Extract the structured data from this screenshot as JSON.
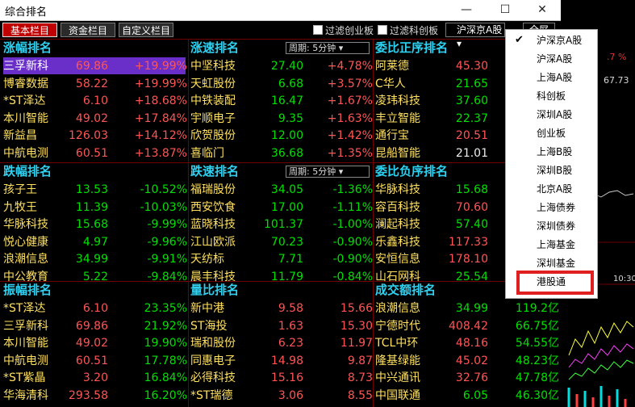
{
  "window": {
    "title": "综合排名",
    "minimize": "—",
    "maximize": "☐",
    "close": "✕"
  },
  "toolbar": {
    "tabs": [
      "基本栏目",
      "资金栏目",
      "自定义栏目"
    ],
    "filter1": "过滤创业板",
    "filter2": "过滤科创板",
    "market": "沪深京A股",
    "full": "全屏"
  },
  "period_label": "周期: 5分钟",
  "panels": {
    "gainers": {
      "title": "涨幅排名",
      "rows": [
        [
          "三孚新科",
          "69.86",
          "+19.99%"
        ],
        [
          "博睿数据",
          "58.22",
          "+19.99%"
        ],
        [
          "*ST泽达",
          "6.10",
          "+18.68%"
        ],
        [
          "本川智能",
          "49.02",
          "+17.84%"
        ],
        [
          "新益昌",
          "126.03",
          "+14.12%"
        ],
        [
          "中航电测",
          "60.51",
          "+13.87%"
        ]
      ]
    },
    "speed_up": {
      "title": "涨速排名",
      "rows": [
        [
          "中坚科技",
          "27.40",
          "+4.78%"
        ],
        [
          "天虹股份",
          "6.68",
          "+3.57%"
        ],
        [
          "中铁装配",
          "16.47",
          "+1.67%"
        ],
        [
          "宇顺电子",
          "9.35",
          "+1.63%"
        ],
        [
          "欣贺股份",
          "12.00",
          "+1.42%"
        ],
        [
          "喜临门",
          "36.68",
          "+1.35%"
        ]
      ]
    },
    "bid_pos": {
      "title": "委比正序排名",
      "rows": [
        [
          "阿莱德",
          "45.30"
        ],
        [
          "C华人",
          "21.65"
        ],
        [
          "凌玮科技",
          "37.60"
        ],
        [
          "丰立智能",
          "22.37"
        ],
        [
          "通行宝",
          "20.51"
        ],
        [
          "昆船智能",
          "21.01"
        ]
      ]
    },
    "losers": {
      "title": "跌幅排名",
      "rows": [
        [
          "孩子王",
          "13.53",
          "-10.52%"
        ],
        [
          "九牧王",
          "11.39",
          "-10.03%"
        ],
        [
          "华脉科技",
          "15.68",
          "-9.99%"
        ],
        [
          "悦心健康",
          "4.97",
          "-9.96%"
        ],
        [
          "浪潮信息",
          "34.99",
          "-9.91%"
        ],
        [
          "中公教育",
          "5.22",
          "-9.84%"
        ]
      ]
    },
    "speed_down": {
      "title": "跌速排名",
      "rows": [
        [
          "福瑞股份",
          "34.05",
          "-1.36%"
        ],
        [
          "西安饮食",
          "17.00",
          "-1.11%"
        ],
        [
          "蓝晓科技",
          "101.37",
          "-1.00%"
        ],
        [
          "江山欧派",
          "70.23",
          "-0.90%"
        ],
        [
          "天纺标",
          "7.71",
          "-0.90%"
        ],
        [
          "晨丰科技",
          "11.79",
          "-0.84%"
        ]
      ]
    },
    "bid_neg": {
      "title": "委比负序排名",
      "rows": [
        [
          "华脉科技",
          "15.68"
        ],
        [
          "容百科技",
          "70.60"
        ],
        [
          "澜起科技",
          "57.40"
        ],
        [
          "乐鑫科技",
          "117.33"
        ],
        [
          "安恒信息",
          "178.10"
        ],
        [
          "山石网科",
          "25.54"
        ]
      ]
    },
    "amplitude": {
      "title": "振幅排名",
      "rows": [
        [
          "*ST泽达",
          "6.10",
          "23.35%"
        ],
        [
          "三孚新科",
          "69.86",
          "21.92%"
        ],
        [
          "本川智能",
          "49.02",
          "19.90%"
        ],
        [
          "中航电测",
          "60.51",
          "17.78%"
        ],
        [
          "*ST紫晶",
          "3.20",
          "16.84%"
        ],
        [
          "华海清科",
          "293.58",
          "16.20%"
        ]
      ]
    },
    "volume_ratio": {
      "title": "量比排名",
      "rows": [
        [
          "新中港",
          "9.58",
          "15.66"
        ],
        [
          "ST海投",
          "1.63",
          "15.30"
        ],
        [
          "瑞和股份",
          "6.23",
          "11.97"
        ],
        [
          "同惠电子",
          "14.98",
          "9.87"
        ],
        [
          "必得科技",
          "15.16",
          "8.73"
        ],
        [
          "*ST瑞德",
          "3.06",
          "8.55"
        ]
      ]
    },
    "turnover": {
      "title": "成交额排名",
      "rows": [
        [
          "浪潮信息",
          "34.99",
          "119.2亿"
        ],
        [
          "宁德时代",
          "408.42",
          "66.75亿"
        ],
        [
          "TCL中环",
          "48.16",
          "54.55亿"
        ],
        [
          "隆基绿能",
          "45.02",
          "48.23亿"
        ],
        [
          "中兴通讯",
          "32.76",
          "47.78亿"
        ],
        [
          "中国联通",
          "6.05",
          "46.30亿"
        ]
      ]
    }
  },
  "dropdown": {
    "items": [
      "沪深京A股",
      "沪深A股",
      "上海A股",
      "科创板",
      "深圳A股",
      "创业板",
      "上海B股",
      "深圳B股",
      "北京A股",
      "上海债券",
      "深圳债券",
      "上海基金",
      "深圳基金",
      "港股通"
    ],
    "checked_index": 0,
    "check_mark": "✔"
  },
  "background": {
    "pct": ".7 %",
    "value": "67.73",
    "time": "10:30"
  },
  "colors": {
    "up": "#ff5555",
    "down": "#00e000",
    "header": "#30d0f0",
    "name": "#ffe060",
    "accent": "#c00000",
    "highlight": "#e02020"
  }
}
